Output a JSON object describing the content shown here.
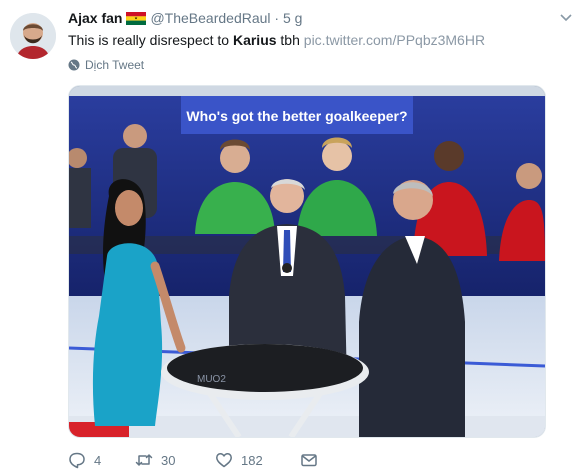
{
  "tweet": {
    "display_name": "Ajax fan",
    "handle": "@TheBeardedRaul",
    "separator": "·",
    "timestamp": "5 g",
    "text_before": "This is really disrespect to ",
    "text_bold": "Karius",
    "text_after": " tbh ",
    "link": "pic.twitter.com/PPqbz3M6HR",
    "translate_label": "Dịch Tweet"
  },
  "media": {
    "banner_text": "Who's got the better goalkeeper?",
    "table_text": "MUO2"
  },
  "actions": {
    "replies": "4",
    "retweets": "30",
    "likes": "182"
  },
  "colors": {
    "link": "#8b98a5",
    "secondary_text": "#657786",
    "flag_red": "#ce1126",
    "flag_gold": "#fcd116",
    "flag_green": "#006b3f"
  },
  "icons": [
    "avatar",
    "ghana-flag-icon",
    "chevron-down-icon",
    "globe-icon",
    "reply-icon",
    "retweet-icon",
    "like-icon",
    "message-icon"
  ]
}
